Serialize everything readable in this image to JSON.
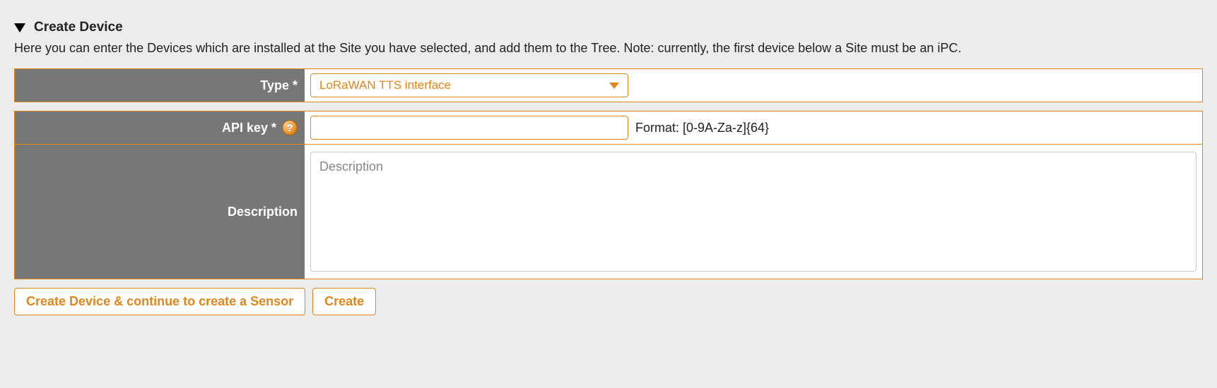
{
  "section": {
    "title": "Create Device",
    "intro": "Here you can enter the Devices which are installed at the Site you have selected, and add them to the Tree. Note: currently, the first device below a Site must be an iPC."
  },
  "fields": {
    "type": {
      "label": "Type *",
      "selected": "LoRaWAN TTS interface"
    },
    "api_key": {
      "label": "API key *",
      "value": "",
      "hint": "Format: [0-9A-Za-z]{64}",
      "help_symbol": "?"
    },
    "description": {
      "label": "Description",
      "placeholder": "Description",
      "value": ""
    }
  },
  "buttons": {
    "create_and_continue": "Create Device & continue to create a Sensor",
    "create": "Create"
  }
}
